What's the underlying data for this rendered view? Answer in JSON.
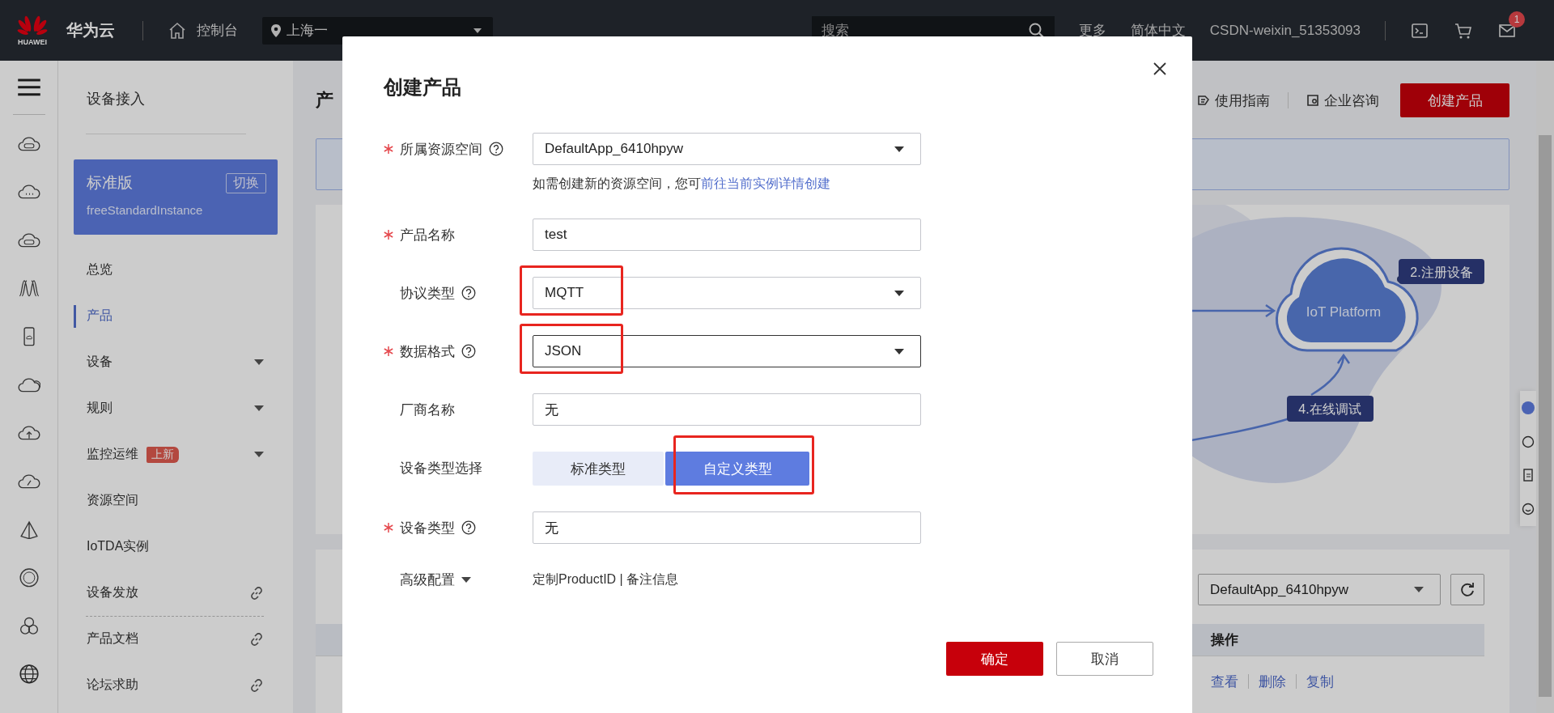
{
  "top_bar": {
    "logo_text": "HUAWEI",
    "brand": "华为云",
    "console": "控制台",
    "region": "上海一",
    "search": {
      "placeholder": "搜索"
    },
    "links": [
      "更多",
      "简体中文"
    ],
    "account": "CSDN-weixin_51353093",
    "mail_badge": "1"
  },
  "sidebar": {
    "title": "设备接入",
    "instance": {
      "edition": "标准版",
      "switch": "切换",
      "name": "freeStandardInstance"
    },
    "items": [
      {
        "label": "总览",
        "kind": "plain",
        "selected": false
      },
      {
        "label": "产品",
        "kind": "plain",
        "selected": true
      },
      {
        "label": "设备",
        "kind": "expand",
        "selected": false
      },
      {
        "label": "规则",
        "kind": "expand",
        "selected": false
      },
      {
        "label": "监控运维",
        "kind": "expand",
        "selected": false,
        "badge": "上新"
      },
      {
        "label": "资源空间",
        "kind": "plain",
        "selected": false
      },
      {
        "label": "IoTDA实例",
        "kind": "plain",
        "selected": false
      },
      {
        "label": "设备发放",
        "kind": "link",
        "selected": false
      },
      {
        "label": "产品文档",
        "kind": "link",
        "selected": false,
        "divider_above": true
      },
      {
        "label": "论坛求助",
        "kind": "link",
        "selected": false
      }
    ]
  },
  "page": {
    "title": "产",
    "links": [
      "使用指南",
      "企业咨询"
    ],
    "create_button": "创建产品",
    "diagram": {
      "center": "IoT Platform",
      "steps": [
        "2.注册设备",
        "4.在线调试"
      ]
    },
    "space_select": "DefaultApp_6410hpyw",
    "table": {
      "columns": [
        "操作"
      ],
      "row_actions": [
        "查看",
        "删除",
        "复制"
      ]
    }
  },
  "dialog": {
    "title": "创建产品",
    "fields": [
      {
        "kind": "select",
        "label": "所属资源空间",
        "required": true,
        "help": true,
        "value": "DefaultApp_6410hpyw",
        "focused": false,
        "hint": "如需创建新的资源空间，您可",
        "hint_link": "前往当前实例详情创建"
      },
      {
        "kind": "input",
        "label": "产品名称",
        "required": true,
        "value": "test",
        "focused": false
      },
      {
        "kind": "select",
        "label": "协议类型",
        "help": true,
        "value": "MQTT",
        "focused": false,
        "highlighted": true
      },
      {
        "kind": "select",
        "label": "数据格式",
        "required": true,
        "help": true,
        "value": "JSON",
        "focused": true,
        "highlighted": true
      },
      {
        "kind": "input",
        "label": "厂商名称",
        "value": "无",
        "focused": false
      },
      {
        "kind": "segmented",
        "label": "设备类型选择",
        "options": [
          {
            "label": "标准类型",
            "selected": false
          },
          {
            "label": "自定义类型",
            "selected": true,
            "highlighted": true
          }
        ]
      },
      {
        "kind": "input",
        "label": "设备类型",
        "required": true,
        "help": true,
        "value": "无",
        "focused": false
      },
      {
        "kind": "expander",
        "label": "高级配置",
        "value": "定制ProductID | 备注信息"
      }
    ],
    "buttons": [
      {
        "label": "确定",
        "kind": "primary"
      },
      {
        "label": "取消",
        "kind": "secondary"
      }
    ]
  }
}
